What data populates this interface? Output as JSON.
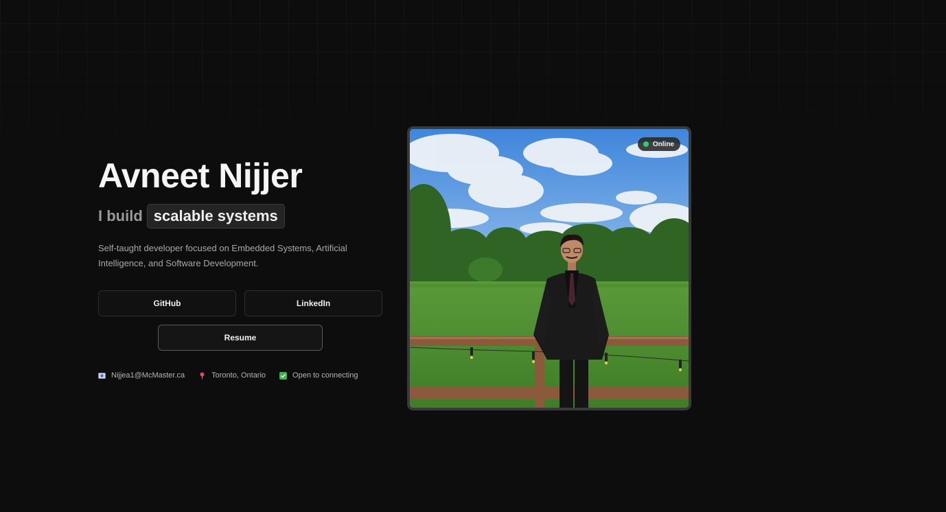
{
  "hero": {
    "name": "Avneet Nijjer",
    "tagline_prefix": "I build",
    "tagline_highlight": "scalable systems",
    "description": "Self-taught developer focused on Embedded Systems, Artificial Intelligence, and Software Development."
  },
  "buttons": {
    "github": "GitHub",
    "linkedin": "LinkedIn",
    "resume": "Resume"
  },
  "contact": {
    "email": "Nijjea1@McMaster.ca",
    "email_icon": "envelope-icon",
    "location": "Toronto, Ontario",
    "location_icon": "pin-icon",
    "availability": "Open to connecting",
    "availability_icon": "check-box-icon"
  },
  "photo": {
    "status": "Online",
    "status_color": "#2ecc71"
  },
  "colors": {
    "background": "#0d0d0d",
    "text": "#f5f5f5",
    "muted": "#a8a8a8",
    "highlight_bg": "#242424",
    "button_border": "#2e2e2e"
  }
}
